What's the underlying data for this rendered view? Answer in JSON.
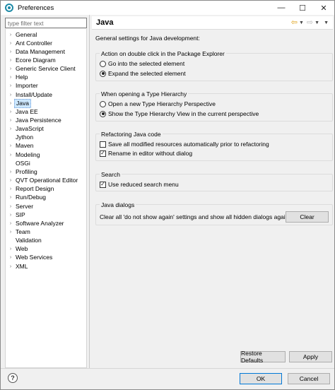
{
  "window": {
    "title": "Preferences",
    "minimize_glyph": "—",
    "maximize_glyph": "☐",
    "close_glyph": "✕"
  },
  "sidebar": {
    "filter_placeholder": "type filter text",
    "items": [
      {
        "label": "General",
        "expandable": true
      },
      {
        "label": "Ant Controller",
        "expandable": true
      },
      {
        "label": "Data Management",
        "expandable": true
      },
      {
        "label": "Ecore Diagram",
        "expandable": true
      },
      {
        "label": "Generic Service Client",
        "expandable": true
      },
      {
        "label": "Help",
        "expandable": true
      },
      {
        "label": "Importer",
        "expandable": true
      },
      {
        "label": "Install/Update",
        "expandable": true
      },
      {
        "label": "Java",
        "expandable": true,
        "selected": true
      },
      {
        "label": "Java EE",
        "expandable": true
      },
      {
        "label": "Java Persistence",
        "expandable": true
      },
      {
        "label": "JavaScript",
        "expandable": true
      },
      {
        "label": "Jython",
        "expandable": false
      },
      {
        "label": "Maven",
        "expandable": true
      },
      {
        "label": "Modeling",
        "expandable": true
      },
      {
        "label": "OSGi",
        "expandable": false
      },
      {
        "label": "Profiling",
        "expandable": true
      },
      {
        "label": "QVT Operational Editor",
        "expandable": true
      },
      {
        "label": "Report Design",
        "expandable": true
      },
      {
        "label": "Run/Debug",
        "expandable": true
      },
      {
        "label": "Server",
        "expandable": true
      },
      {
        "label": "SIP",
        "expandable": true
      },
      {
        "label": "Software Analyzer",
        "expandable": true
      },
      {
        "label": "Team",
        "expandable": true
      },
      {
        "label": "Validation",
        "expandable": false
      },
      {
        "label": "Web",
        "expandable": true
      },
      {
        "label": "Web Services",
        "expandable": true
      },
      {
        "label": "XML",
        "expandable": true
      }
    ]
  },
  "page": {
    "title": "Java",
    "description": "General settings for Java development:",
    "groups": {
      "double_click": {
        "title": "Action on double click in the Package Explorer",
        "options": [
          {
            "label": "Go into the selected element",
            "checked": false
          },
          {
            "label": "Expand the selected element",
            "checked": true
          }
        ]
      },
      "type_hierarchy": {
        "title": "When opening a Type Hierarchy",
        "options": [
          {
            "label": "Open a new Type Hierarchy Perspective",
            "checked": false
          },
          {
            "label": "Show the Type Hierarchy View in the current perspective",
            "checked": true
          }
        ]
      },
      "refactoring": {
        "title": "Refactoring Java code",
        "options": [
          {
            "label": "Save all modified resources automatically prior to refactoring",
            "checked": false
          },
          {
            "label": "Rename in editor without dialog",
            "checked": true
          }
        ]
      },
      "search": {
        "title": "Search",
        "options": [
          {
            "label": "Use reduced search menu",
            "checked": true
          }
        ]
      },
      "java_dialogs": {
        "title": "Java dialogs",
        "text": "Clear all 'do not show again' settings and show all hidden dialogs again",
        "clear_label": "Clear"
      }
    },
    "restore_defaults_label": "Restore Defaults",
    "apply_label": "Apply"
  },
  "footer": {
    "help_glyph": "?",
    "ok_label": "OK",
    "cancel_label": "Cancel"
  }
}
